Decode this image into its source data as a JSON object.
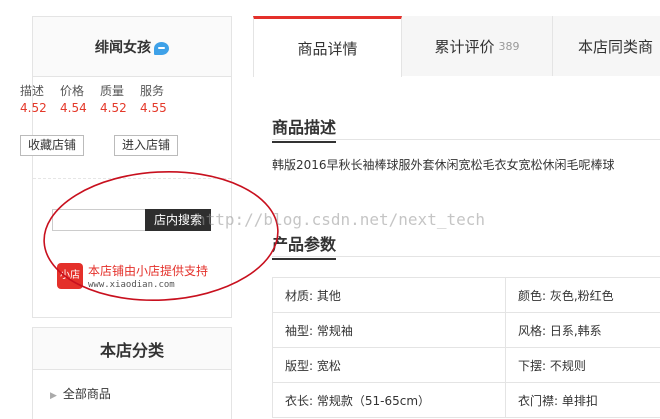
{
  "shop": {
    "name": "绯闻女孩",
    "scores": [
      {
        "label": "描述",
        "value": "4.52"
      },
      {
        "label": "价格",
        "value": "4.54"
      },
      {
        "label": "质量",
        "value": "4.52"
      },
      {
        "label": "服务",
        "value": "4.55"
      }
    ],
    "favorite_label": "收藏店铺",
    "enter_label": "进入店铺",
    "search_button": "店内搜索",
    "search_value": "",
    "provider_logo": "小店",
    "provider_text": "本店铺由小店提供支持",
    "provider_url": "www.xiaodian.com"
  },
  "category": {
    "title": "本店分类",
    "items": [
      "全部商品"
    ]
  },
  "tabs": [
    {
      "label": "商品详情",
      "count": ""
    },
    {
      "label": "累计评价",
      "count": "389"
    },
    {
      "label": "本店同类商",
      "count": ""
    }
  ],
  "description": {
    "title": "商品描述",
    "text": "韩版2016早秋长袖棒球服外套休闲宽松毛衣女宽松休闲毛呢棒球"
  },
  "params": {
    "title": "产品参数",
    "rows": [
      [
        "材质: 其他",
        "颜色: 灰色,粉红色"
      ],
      [
        "袖型: 常规袖",
        "风格: 日系,韩系"
      ],
      [
        "版型: 宽松",
        "下摆: 不规则"
      ],
      [
        "衣长: 常规款（51-65cm）",
        "衣门襟: 单排扣"
      ]
    ]
  },
  "watermark": "http://blog.csdn.net/next_tech",
  "colors": {
    "accent": "#e4302a",
    "annotation": "#c8101e"
  }
}
